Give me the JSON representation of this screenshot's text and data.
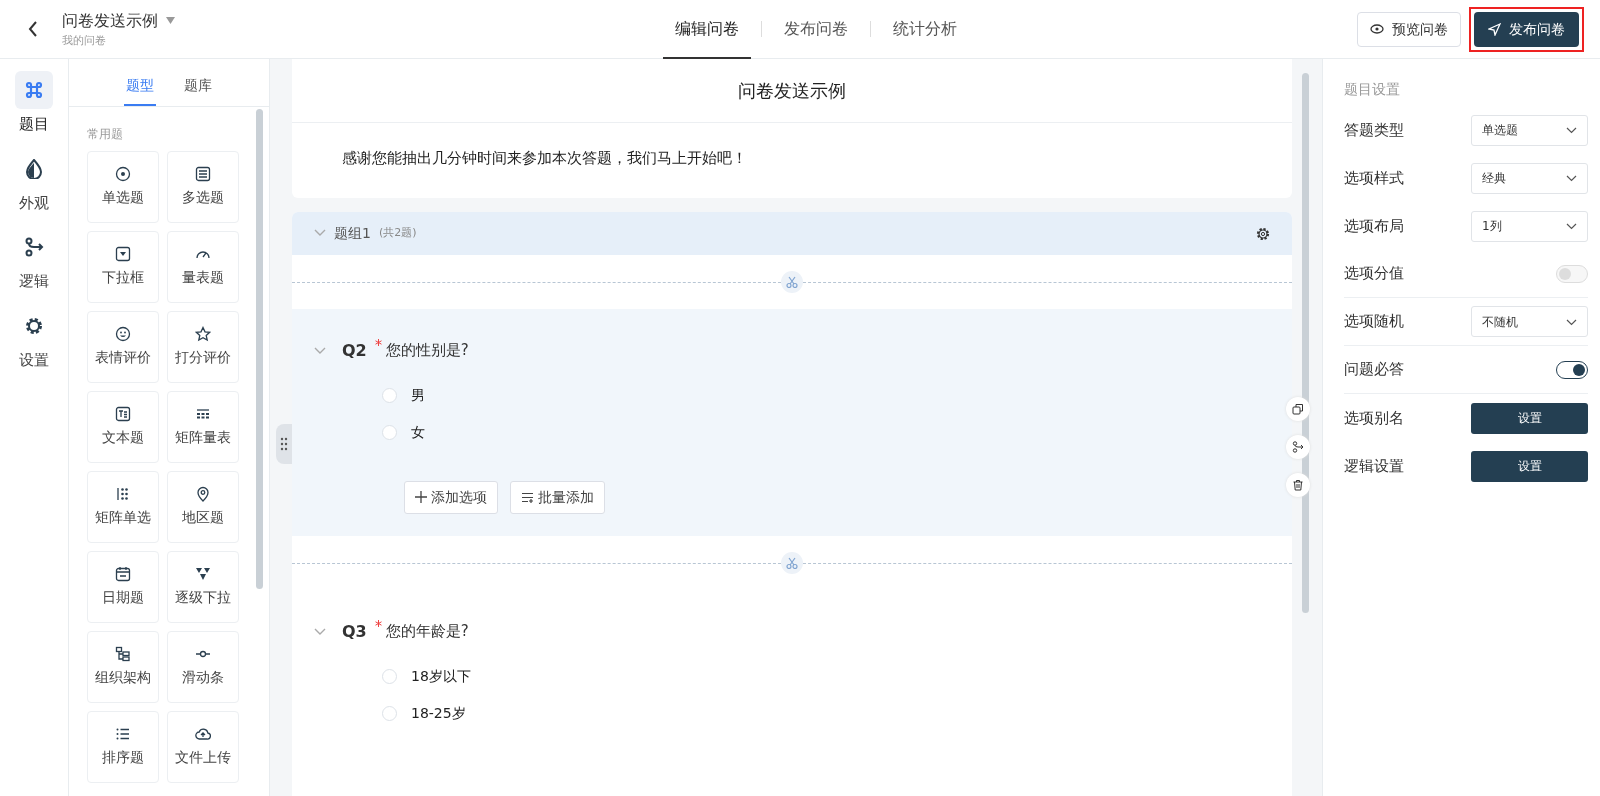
{
  "header": {
    "title": "问卷发送示例",
    "subtitle": "我的问卷",
    "tabs": [
      {
        "label": "编辑问卷",
        "selected": true
      },
      {
        "label": "发布问卷",
        "selected": false
      },
      {
        "label": "统计分析",
        "selected": false
      }
    ],
    "preview_button": "预览问卷",
    "publish_button": "发布问卷"
  },
  "rail": [
    {
      "label": "题目",
      "selected": true
    },
    {
      "label": "外观",
      "selected": false
    },
    {
      "label": "逻辑",
      "selected": false
    },
    {
      "label": "设置",
      "selected": false
    }
  ],
  "panel": {
    "tabs": [
      {
        "label": "题型",
        "selected": true
      },
      {
        "label": "题库",
        "selected": false
      }
    ],
    "section": "常用题",
    "types": [
      "单选题",
      "多选题",
      "下拉框",
      "量表题",
      "表情评价",
      "打分评价",
      "文本题",
      "矩阵量表",
      "矩阵单选",
      "地区题",
      "日期题",
      "逐级下拉",
      "组织架构",
      "滑动条",
      "排序题",
      "文件上传"
    ]
  },
  "survey": {
    "title": "问卷发送示例",
    "intro": "感谢您能抽出几分钟时间来参加本次答题，我们马上开始吧！",
    "group": {
      "name": "题组1",
      "count": "(共2题)",
      "expanded": true
    },
    "questions": [
      {
        "number": "Q2",
        "required": true,
        "title": "您的性别是?",
        "selected": true,
        "options": [
          {
            "label": "男",
            "selected": false
          },
          {
            "label": "女",
            "selected": false
          }
        ],
        "add_option": "添加选项",
        "bulk_add": "批量添加"
      },
      {
        "number": "Q3",
        "required": true,
        "title": "您的年龄是?",
        "selected": false,
        "options": [
          {
            "label": "18岁以下",
            "selected": false
          },
          {
            "label": "18-25岁",
            "selected": false
          }
        ]
      }
    ]
  },
  "settings": {
    "title": "题目设置",
    "rows": [
      {
        "kind": "select",
        "label": "答题类型",
        "value": "单选题"
      },
      {
        "kind": "select",
        "label": "选项样式",
        "value": "经典"
      },
      {
        "kind": "select",
        "label": "选项布局",
        "value": "1列"
      },
      {
        "kind": "switch",
        "label": "选项分值",
        "on": false
      },
      {
        "kind": "select",
        "label": "选项随机",
        "value": "不随机"
      },
      {
        "kind": "switch",
        "label": "问题必答",
        "on": true
      },
      {
        "kind": "button",
        "label": "选项别名",
        "value": "设置"
      },
      {
        "kind": "button",
        "label": "逻辑设置",
        "value": "设置"
      }
    ]
  }
}
